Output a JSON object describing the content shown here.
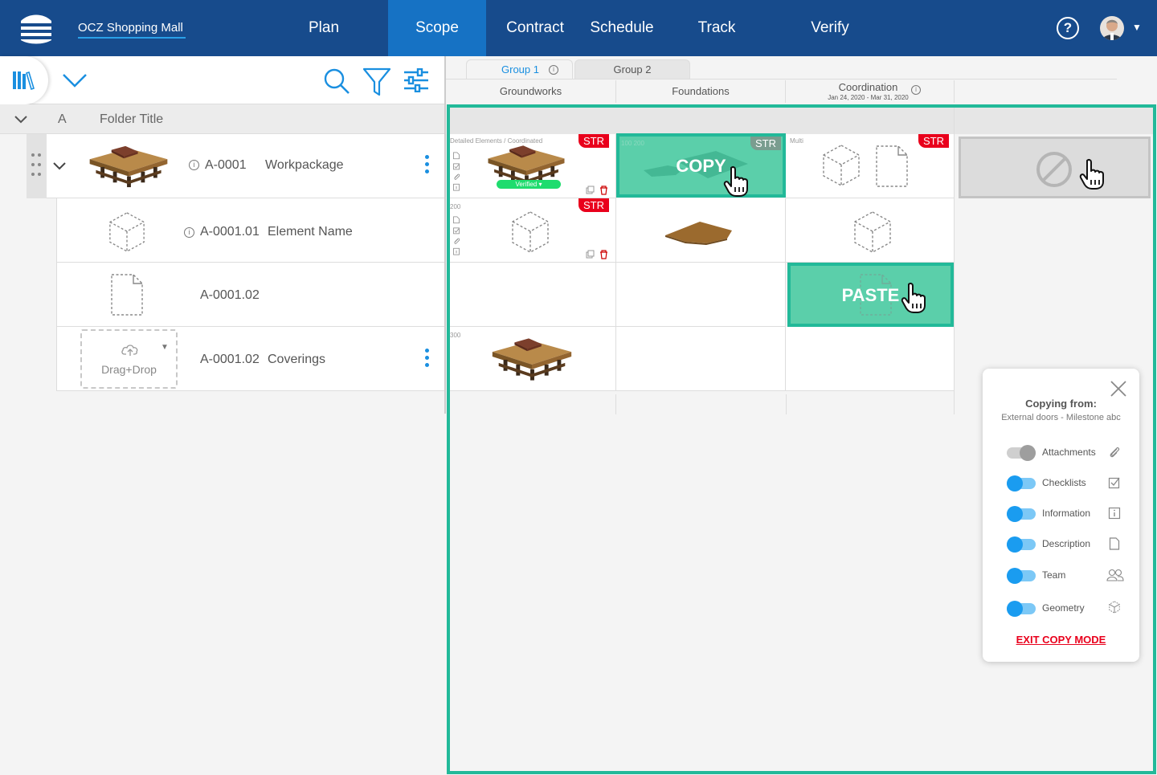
{
  "header": {
    "project_title": "OCZ Shopping Mall",
    "nav": [
      "Plan",
      "Scope",
      "Contract",
      "Schedule",
      "Track",
      "Verify"
    ],
    "active_nav": "Scope",
    "help_label": "?"
  },
  "colors": {
    "brand": "#174b8c",
    "active": "#1672c4",
    "accent": "#22b999",
    "tag": "#e9001c",
    "toggle_on": "#1a9cf0"
  },
  "left": {
    "col_letter": "A",
    "col_title": "Folder Title",
    "rows": [
      {
        "id": "A-0001",
        "name": "Workpackage"
      },
      {
        "id": "A-0001.01",
        "name": "Element Name"
      },
      {
        "id": "A-0001.02",
        "name": ""
      },
      {
        "id": "A-0001.02",
        "name": "Coverings"
      }
    ],
    "dragdrop_label": "Drag+Drop"
  },
  "grid": {
    "tabs": [
      "Group 1",
      "Group 2"
    ],
    "columns": [
      {
        "name": "Groundworks",
        "dates": ""
      },
      {
        "name": "Foundations",
        "dates": ""
      },
      {
        "name": "Coordination",
        "dates": "Jan 24, 2020 - Mar 31, 2020"
      }
    ],
    "tag": "STR",
    "cell_labels": {
      "c00": "Detailed Elements / Coordinated",
      "c01": "100 200",
      "c02": "Multi",
      "c10": "200",
      "c30": "300"
    },
    "verified_label": "Verified",
    "copy_label": "COPY",
    "paste_label": "PASTE"
  },
  "copy_panel": {
    "title": "Copying from:",
    "source": "External doors - Milestone abc",
    "options": [
      {
        "label": "Attachments",
        "on": false,
        "icon": "paperclip-icon"
      },
      {
        "label": "Checklists",
        "on": true,
        "icon": "checkbox-icon"
      },
      {
        "label": "Information",
        "on": true,
        "icon": "info-icon"
      },
      {
        "label": "Description",
        "on": true,
        "icon": "document-icon"
      },
      {
        "label": "Team",
        "on": true,
        "icon": "team-icon"
      },
      {
        "label": "Geometry",
        "on": true,
        "icon": "geometry-icon"
      }
    ],
    "exit_label": "EXIT COPY MODE"
  }
}
